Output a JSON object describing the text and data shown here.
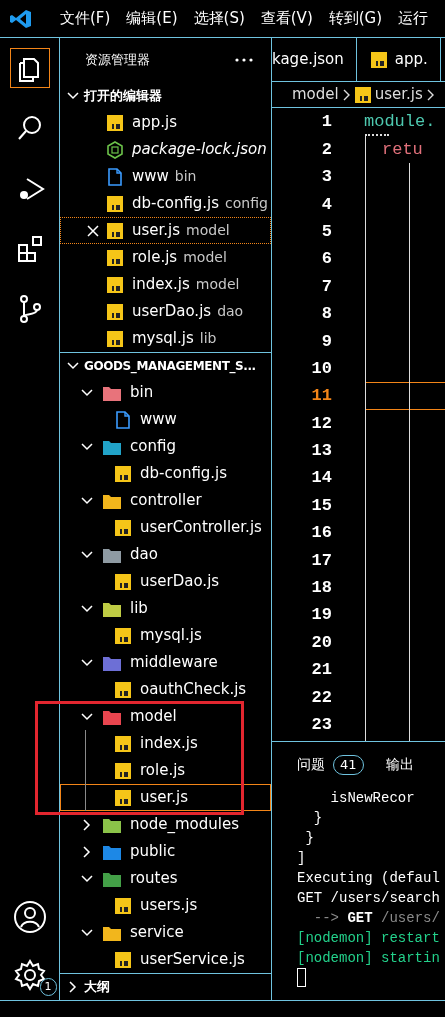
{
  "menu": [
    "文件(F)",
    "编辑(E)",
    "选择(S)",
    "查看(V)",
    "转到(G)",
    "运行"
  ],
  "activity_bar": {
    "items": [
      {
        "kind": "explorer",
        "selected": true
      },
      {
        "kind": "search",
        "selected": false
      },
      {
        "kind": "debug",
        "selected": false
      },
      {
        "kind": "extensions",
        "selected": false
      },
      {
        "kind": "git",
        "selected": false
      }
    ],
    "settings_badge": "1"
  },
  "sidebar": {
    "title": "资源管理器",
    "open_editors": {
      "title": "打开的编辑器",
      "expanded": true,
      "items": [
        {
          "name": "app.js",
          "kind": "js",
          "italic": false,
          "selected": false
        },
        {
          "name": "package-lock.json",
          "kind": "node",
          "italic": true,
          "selected": false
        },
        {
          "name": "www",
          "folder": "bin",
          "kind": "file",
          "italic": false,
          "selected": false
        },
        {
          "name": "db-config.js",
          "folder": "config",
          "kind": "js",
          "italic": false,
          "selected": false
        },
        {
          "name": "user.js",
          "folder": "model",
          "kind": "js",
          "italic": false,
          "selected": true
        },
        {
          "name": "role.js",
          "folder": "model",
          "kind": "js",
          "italic": false,
          "selected": false
        },
        {
          "name": "index.js",
          "folder": "model",
          "kind": "js",
          "italic": false,
          "selected": false
        },
        {
          "name": "userDao.js",
          "folder": "dao",
          "kind": "js",
          "italic": false,
          "selected": false
        },
        {
          "name": "mysql.js",
          "folder": "lib",
          "kind": "js",
          "italic": false,
          "selected": false
        }
      ]
    },
    "project": {
      "title": "GOODS_MANAGEMENT_S...",
      "expanded": true,
      "children": [
        {
          "name": "bin",
          "color": "#e8737b",
          "expanded": true,
          "highlighted": false,
          "children": [
            {
              "name": "www",
              "kind": "file",
              "selected": false
            }
          ]
        },
        {
          "name": "config",
          "color": "#21a3c8",
          "expanded": true,
          "highlighted": false,
          "children": [
            {
              "name": "db-config.js",
              "kind": "js",
              "selected": false
            }
          ]
        },
        {
          "name": "controller",
          "color": "#f2b61c",
          "expanded": true,
          "highlighted": false,
          "children": [
            {
              "name": "userController.js",
              "kind": "js",
              "selected": false
            }
          ]
        },
        {
          "name": "dao",
          "color": "#8f9ba3",
          "expanded": true,
          "highlighted": false,
          "children": [
            {
              "name": "userDao.js",
              "kind": "js",
              "selected": false
            }
          ]
        },
        {
          "name": "lib",
          "color": "#bfcc44",
          "expanded": true,
          "highlighted": false,
          "children": [
            {
              "name": "mysql.js",
              "kind": "js",
              "selected": false
            }
          ]
        },
        {
          "name": "middleware",
          "color": "#6e6fd6",
          "expanded": true,
          "highlighted": false,
          "children": [
            {
              "name": "oauthCheck.js",
              "kind": "js",
              "selected": false
            }
          ]
        },
        {
          "name": "model",
          "color": "#e8464f",
          "expanded": true,
          "highlighted": true,
          "children": [
            {
              "name": "index.js",
              "kind": "js",
              "selected": false
            },
            {
              "name": "role.js",
              "kind": "js",
              "selected": false
            },
            {
              "name": "user.js",
              "kind": "js",
              "selected": true
            }
          ]
        },
        {
          "name": "node_modules",
          "color": "#8bc34a",
          "expanded": false,
          "highlighted": false
        },
        {
          "name": "public",
          "color": "#1e88e5",
          "expanded": false,
          "highlighted": false
        },
        {
          "name": "routes",
          "color": "#43a047",
          "expanded": true,
          "highlighted": false,
          "children": [
            {
              "name": "users.js",
              "kind": "js",
              "selected": false
            }
          ]
        },
        {
          "name": "service",
          "color": "#f2b61c",
          "expanded": true,
          "highlighted": false,
          "children": [
            {
              "name": "userService.js",
              "kind": "js",
              "selected": false
            }
          ]
        }
      ]
    },
    "outline": {
      "title": "大纲",
      "expanded": false
    }
  },
  "editor": {
    "tabs": [
      {
        "label": "kage.json",
        "kind": "none",
        "selected": false
      },
      {
        "label": "app.",
        "kind": "js",
        "selected": false
      }
    ],
    "breadcrumb": [
      "model",
      "user.js"
    ],
    "lines": [
      {
        "number": "1",
        "code": "module.",
        "kind": "ident",
        "selected": false
      },
      {
        "number": "2",
        "code": "retu",
        "kind": "keyword",
        "selected": false
      },
      {
        "number": "3",
        "selected": false
      },
      {
        "number": "4",
        "selected": false
      },
      {
        "number": "5",
        "selected": false
      },
      {
        "number": "6",
        "selected": false
      },
      {
        "number": "7",
        "selected": false
      },
      {
        "number": "8",
        "selected": false
      },
      {
        "number": "9",
        "selected": false
      },
      {
        "number": "10",
        "selected": false
      },
      {
        "number": "11",
        "selected": true
      },
      {
        "number": "12",
        "selected": false
      },
      {
        "number": "13",
        "selected": false
      },
      {
        "number": "14",
        "selected": false
      },
      {
        "number": "15",
        "selected": false
      },
      {
        "number": "16",
        "selected": false
      },
      {
        "number": "17",
        "selected": false
      },
      {
        "number": "18",
        "selected": false
      },
      {
        "number": "19",
        "selected": false
      },
      {
        "number": "20",
        "selected": false
      },
      {
        "number": "21",
        "selected": false
      },
      {
        "number": "22",
        "selected": false
      },
      {
        "number": "23",
        "selected": false
      }
    ]
  },
  "panel": {
    "tabs": [
      {
        "label": "问题",
        "badge": "41",
        "selected": false
      },
      {
        "label": "输出",
        "selected": false
      }
    ],
    "terminal": [
      {
        "kind": "plain",
        "segments": [
          {
            "text": "    isNewRecor",
            "kind": "plain"
          }
        ]
      },
      {
        "kind": "plain",
        "segments": [
          {
            "text": "  }",
            "kind": "plain"
          }
        ]
      },
      {
        "kind": "plain",
        "segments": [
          {
            "text": " }",
            "kind": "plain"
          }
        ]
      },
      {
        "kind": "plain",
        "segments": [
          {
            "text": "]",
            "kind": "plain"
          }
        ]
      },
      {
        "kind": "plain",
        "segments": [
          {
            "text": "Executing (defaul",
            "kind": "plain"
          }
        ]
      },
      {
        "kind": "plain",
        "segments": [
          {
            "text": "GET /users/search",
            "kind": "plain"
          }
        ]
      },
      {
        "kind": "plain",
        "segments": [
          {
            "text": "  -->",
            "kind": "muted"
          },
          {
            "text": " GET",
            "kind": "bold"
          },
          {
            "text": " /users/",
            "kind": "muted"
          }
        ]
      },
      {
        "kind": "plain",
        "segments": [
          {
            "text": "[nodemon] restart",
            "kind": "success"
          }
        ]
      },
      {
        "kind": "plain",
        "segments": [
          {
            "text": "[nodemon] startin",
            "kind": "success"
          }
        ]
      },
      {
        "kind": "cursor"
      }
    ]
  }
}
